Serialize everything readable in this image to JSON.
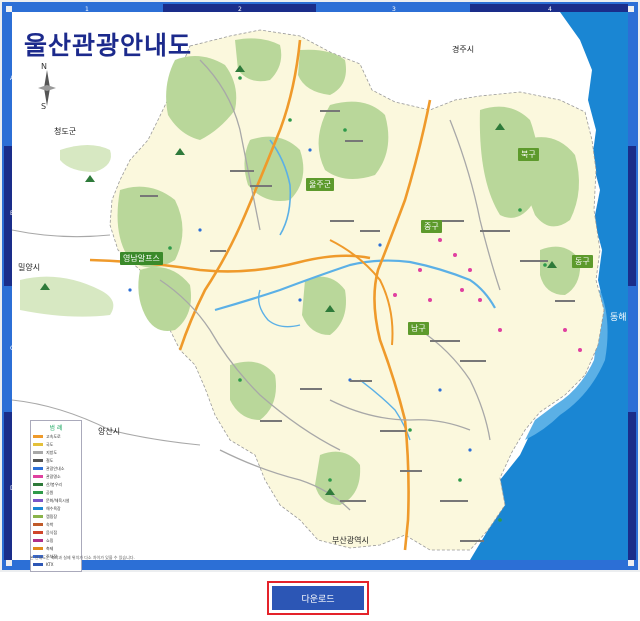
{
  "map": {
    "title": "울산관광안내도",
    "compass": {
      "n": "N",
      "s": "S"
    },
    "grid_cols": [
      "1",
      "2",
      "3",
      "4"
    ],
    "grid_rows": [
      "A",
      "B",
      "C",
      "D"
    ],
    "labels": {
      "gyeongju": "경주시",
      "gyeongdogun": "청도군",
      "miryang": "밀양시",
      "yangsan": "양산시",
      "busan": "부산광역시",
      "ulju": "울주군",
      "junggu": "중구",
      "namgu": "남구",
      "bukgu": "북구",
      "donggu": "동구",
      "donghae": "동해",
      "yeongnam_alps": "영남알프스"
    },
    "legend": {
      "title": "범 례",
      "items": [
        "고속도로",
        "국도",
        "지방도",
        "철도",
        "관광안내소",
        "관광명소",
        "산/봉우리",
        "공원",
        "문화/체육시설",
        "해수욕장",
        "캠핑장",
        "숙박",
        "음식점",
        "쇼핑",
        "축제",
        "주차장",
        "KTX"
      ]
    },
    "footnote": "본 안내도는 축척과 실제 위치가 다소 차이가 있을 수 있습니다."
  },
  "download_label": "다운로드",
  "colors": {
    "title": "#1c2a8c",
    "frame": "#2c6fd6",
    "land": "#fbf8dd",
    "mountain": "#b9d79a",
    "sea": "#1a86d3",
    "road": "#ef9a2b",
    "button": "#2c56b5",
    "button_border": "#e4232a"
  }
}
